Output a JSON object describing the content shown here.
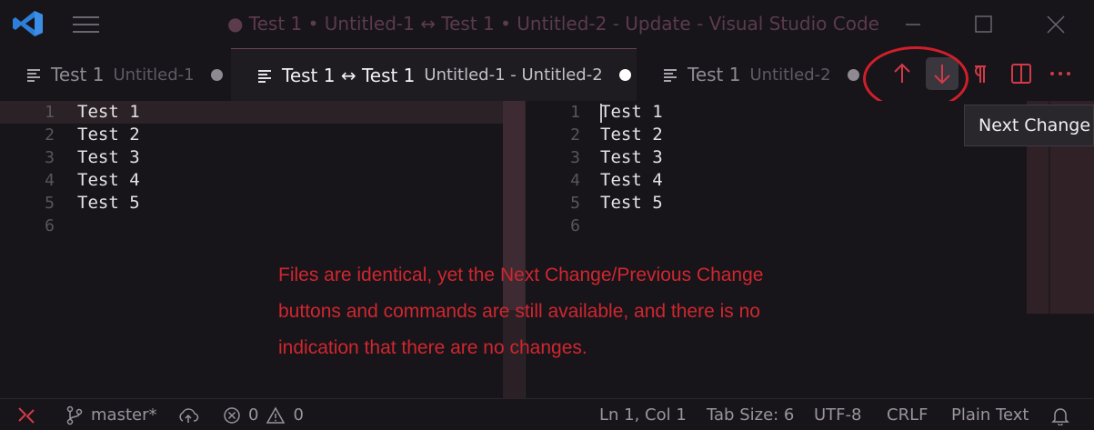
{
  "window": {
    "title": "● Test 1 • Untitled-1 ↔ Test 1 • Untitled-2 - Update - Visual Studio Code"
  },
  "tabs": [
    {
      "name": "Test 1",
      "description": "Untitled-1",
      "dirty": true,
      "active": false
    },
    {
      "name": "Test 1 ↔ Test 1",
      "description": "Untitled-1 - Untitled-2",
      "dirty": true,
      "active": true
    },
    {
      "name": "Test 1",
      "description": "Untitled-2",
      "dirty": true,
      "active": false
    }
  ],
  "editor_actions": {
    "previous_change_icon": "arrow-up-icon",
    "next_change_icon": "arrow-down-icon",
    "split_icon": "split-editor-icon",
    "more_icon": "ellipsis-icon"
  },
  "tooltip": "Next Change",
  "left_editor": {
    "lines": [
      {
        "num": "1",
        "text": "Test 1"
      },
      {
        "num": "2",
        "text": "Test 2"
      },
      {
        "num": "3",
        "text": "Test 3"
      },
      {
        "num": "4",
        "text": "Test 4"
      },
      {
        "num": "5",
        "text": "Test 5"
      },
      {
        "num": "6",
        "text": ""
      }
    ]
  },
  "right_editor": {
    "lines": [
      {
        "num": "1",
        "text": "Test 1"
      },
      {
        "num": "2",
        "text": "Test 2"
      },
      {
        "num": "3",
        "text": "Test 3"
      },
      {
        "num": "4",
        "text": "Test 4"
      },
      {
        "num": "5",
        "text": "Test 5"
      },
      {
        "num": "6",
        "text": ""
      }
    ]
  },
  "annotation": {
    "lines": [
      "Files are identical, yet the Next Change/Previous Change",
      "buttons and commands are still available, and there is no",
      "indication that there are no changes."
    ],
    "color": "#d0262f"
  },
  "statusbar": {
    "branch": "master*",
    "errors": "0",
    "warnings": "0",
    "position": "Ln 1, Col 1",
    "tab_size": "Tab Size: 6",
    "encoding": "UTF-8",
    "eol": "CRLF",
    "language": "Plain Text"
  },
  "colors": {
    "accent": "#d0262f",
    "logo": "#2d7ed8",
    "background": "#17151a"
  }
}
